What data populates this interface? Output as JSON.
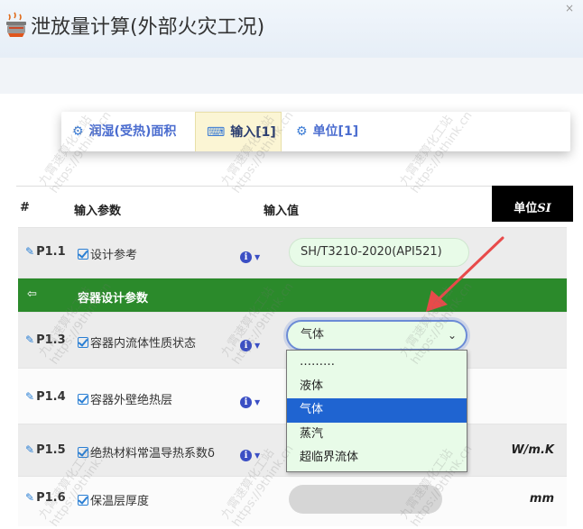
{
  "header": {
    "title": "泄放量计算(外部火灾工况)"
  },
  "tabs": [
    {
      "icon": "gears-icon",
      "label": "润湿(受热)面积"
    },
    {
      "icon": "keyboard-icon",
      "label": "输入[1]"
    },
    {
      "icon": "gears-icon",
      "label": "单位[1]"
    }
  ],
  "table": {
    "col_hash": "#",
    "col_param": "输入参数",
    "col_value": "输入值",
    "col_unit": "单位",
    "col_unit_suffix": "SI"
  },
  "rows": {
    "p1_1": {
      "id": "P1.1",
      "name": "设计参考",
      "value": "SH/T3210-2020(API521)"
    },
    "section": {
      "label": "容器设计参数"
    },
    "p1_3": {
      "id": "P1.3",
      "name": "容器内流体性质状态",
      "value": "气体"
    },
    "p1_4": {
      "id": "P1.4",
      "name": "容器外壁绝热层"
    },
    "p1_5": {
      "id": "P1.5",
      "name": "绝热材料常温导热系数δ",
      "unit": "W/m.K"
    },
    "p1_6": {
      "id": "P1.6",
      "name": "保温层厚度",
      "unit": "mm"
    }
  },
  "dropdown": {
    "options": [
      "………",
      "液体",
      "气体",
      "蒸汽",
      "超临界流体"
    ],
    "selected": "气体"
  },
  "watermark": {
    "line1": "九霄速算化工站",
    "line2": "https://9think.cn"
  },
  "colors": {
    "section_green": "#2b8a2b",
    "tab_active": "#fbf5d4",
    "option_selected": "#1f64d1",
    "arrow": "#e84a4a"
  }
}
